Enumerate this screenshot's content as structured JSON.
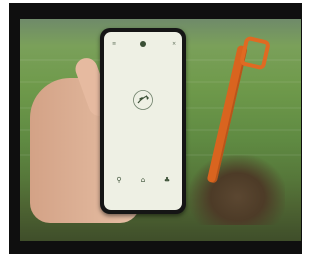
{
  "screen": {
    "title_line1": "",
    "title_line2": "",
    "subtitle": ""
  },
  "tabbar": [
    {
      "icon": "plant-icon",
      "label": ""
    },
    {
      "icon": "home-icon",
      "label": ""
    },
    {
      "icon": "sprout-icon",
      "label": ""
    }
  ],
  "colors": {
    "screen_bg": "#eef0e4",
    "accent": "#3a4f35",
    "shovel": "#d9641f"
  }
}
